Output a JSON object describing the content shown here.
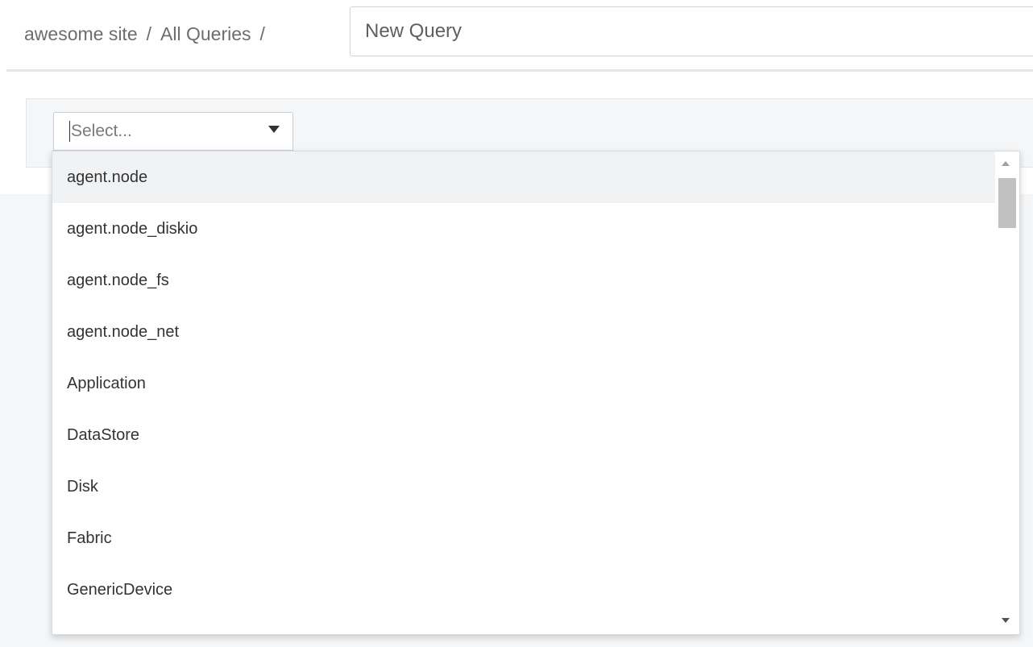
{
  "breadcrumb": {
    "site": "awesome site",
    "separator": "/",
    "section": "All Queries"
  },
  "query_name": {
    "value": "New Query"
  },
  "filter": {
    "select_placeholder": "Select...",
    "options": [
      "agent.node",
      "agent.node_diskio",
      "agent.node_fs",
      "agent.node_net",
      "Application",
      "DataStore",
      "Disk",
      "Fabric",
      "GenericDevice"
    ],
    "highlighted_index": 0
  },
  "colors": {
    "panel_background": "#f4f6f8",
    "option_highlight": "#f1f2f4",
    "text": "#333333",
    "muted_text": "#6d6d6d"
  }
}
